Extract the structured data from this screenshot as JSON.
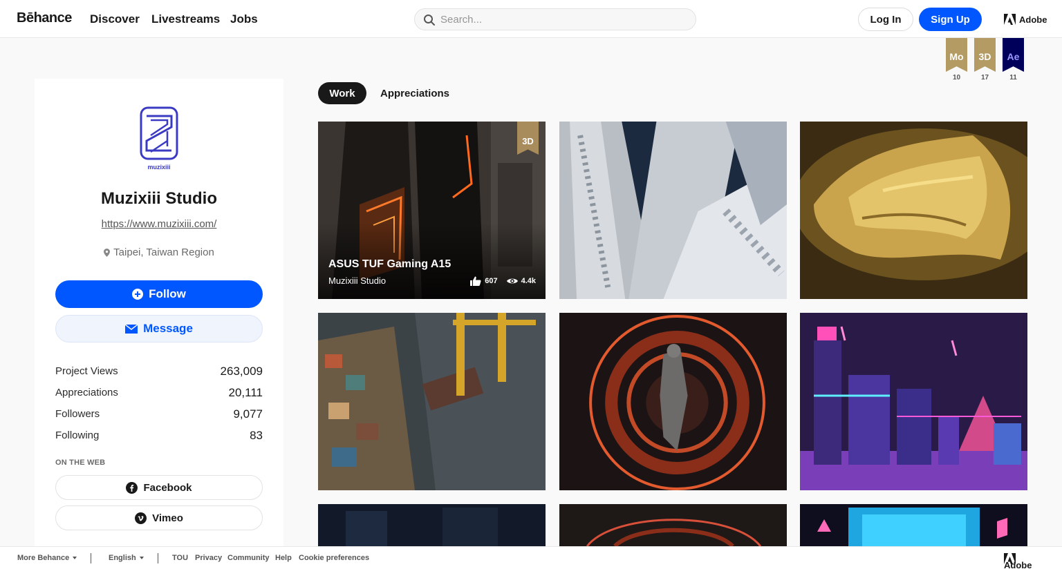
{
  "header": {
    "logo": "Bēhance",
    "nav": [
      "Discover",
      "Livestreams",
      "Jobs"
    ],
    "search_placeholder": "Search...",
    "login_label": "Log In",
    "signup_label": "Sign Up",
    "adobe_label": "Adobe"
  },
  "badges": [
    {
      "label": "Mo",
      "count": "10",
      "color": "#b39b63"
    },
    {
      "label": "3D",
      "count": "17",
      "color": "#b39b63"
    },
    {
      "label": "Ae",
      "count": "11",
      "color": "#00005b"
    }
  ],
  "profile": {
    "avatar_text": "muzixiii",
    "name": "Muzixiii Studio",
    "url": "https://www.muzixiii.com/",
    "location": "Taipei, Taiwan Region",
    "follow_label": "Follow",
    "message_label": "Message",
    "stats": [
      {
        "label": "Project Views",
        "value": "263,009"
      },
      {
        "label": "Appreciations",
        "value": "20,111"
      },
      {
        "label": "Followers",
        "value": "9,077"
      },
      {
        "label": "Following",
        "value": "83"
      }
    ],
    "web_title": "ON THE WEB",
    "web_links": [
      {
        "label": "Facebook",
        "icon": "facebook-icon"
      },
      {
        "label": "Vimeo",
        "icon": "vimeo-icon"
      }
    ]
  },
  "tabs": [
    {
      "label": "Work",
      "active": true
    },
    {
      "label": "Appreciations",
      "active": false
    }
  ],
  "projects": [
    {
      "title": "ASUS TUF Gaming A15",
      "owner": "Muzixiii Studio",
      "likes": "607",
      "views": "4.4k",
      "badge": "3D"
    }
  ],
  "footer": {
    "more": "More Behance",
    "language": "English",
    "links": [
      "TOU",
      "Privacy",
      "Community",
      "Help",
      "Cookie preferences"
    ],
    "adobe_label": "Adobe"
  },
  "colors": {
    "brand_blue": "#0057ff",
    "badge_gold": "#b39b63",
    "badge_navy": "#00005b"
  }
}
